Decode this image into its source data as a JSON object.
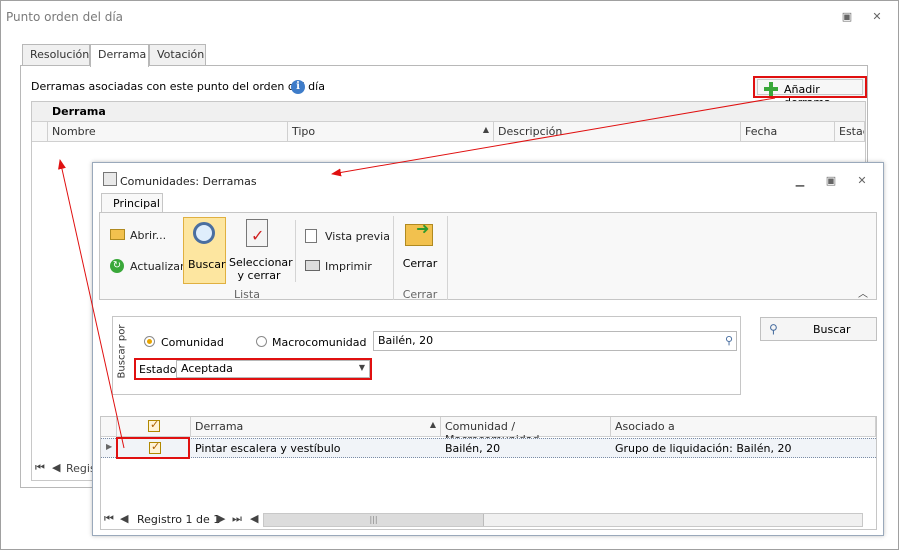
{
  "outer_window": {
    "title": "Punto orden del día",
    "tabs": [
      "Resolución",
      "Derrama",
      "Votación"
    ],
    "active_tab": "Derrama",
    "description": "Derramas asociadas con este punto del orden del día",
    "add_button_label": "Añadir derrama",
    "grid": {
      "group_header": "Derrama",
      "columns": [
        "Nombre",
        "Tipo",
        "Descripción",
        "Fecha",
        "Estad"
      ],
      "pager_text": "Regis"
    }
  },
  "dialog": {
    "title": "Comunidades: Derramas",
    "ribbon_tab": "Principal",
    "buttons": {
      "open": "Abrir...",
      "refresh": "Actualizar",
      "search": "Buscar",
      "select_close_line1": "Seleccionar",
      "select_close_line2": "y cerrar",
      "preview": "Vista previa",
      "print": "Imprimir",
      "close": "Cerrar"
    },
    "groups": {
      "list": "Lista",
      "close": "Cerrar"
    },
    "filter": {
      "search_by_label": "Buscar por",
      "option_community": "Comunidad",
      "option_macro": "Macrocomunidad",
      "community_value": "Bailén, 20",
      "state_label": "Estado",
      "state_value": "Aceptada",
      "search_button": "Buscar"
    },
    "grid": {
      "columns": [
        "Derrama",
        "Comunidad / Macrocomunidad",
        "Asociado a"
      ],
      "rows": [
        {
          "checked": true,
          "derrama": "Pintar escalera y vestíbulo",
          "comunidad": "Bailén, 20",
          "asociado": "Grupo de liquidación: Bailén, 20"
        }
      ],
      "pager_text": "Registro 1 de 1"
    }
  },
  "colors": {
    "highlight_red": "#e01010",
    "accent_green": "#3aa83a",
    "info_blue": "#3e7cc9"
  }
}
